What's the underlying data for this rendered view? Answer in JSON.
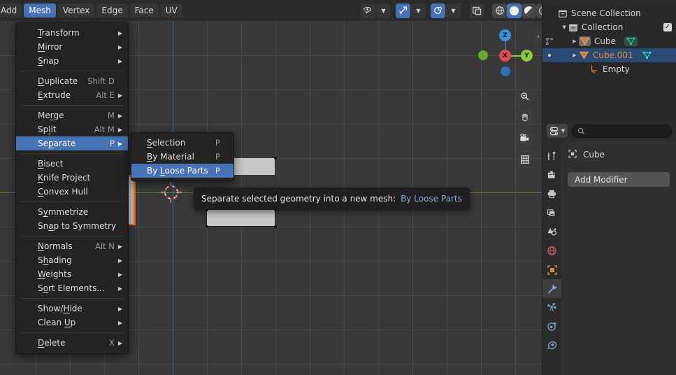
{
  "app": "Blender",
  "viewport": {
    "header": {
      "menus": [
        {
          "label": "Add",
          "active": false
        },
        {
          "label": "Mesh",
          "active": true
        },
        {
          "label": "Vertex",
          "active": false
        },
        {
          "label": "Edge",
          "active": false
        },
        {
          "label": "Face",
          "active": false
        },
        {
          "label": "UV",
          "active": false
        }
      ],
      "tools": [
        {
          "name": "visibility-selectability-icon",
          "label": "",
          "state": "off"
        },
        {
          "name": "snap-magnet-icon",
          "label": "",
          "state": "on"
        },
        {
          "name": "proportional-editing-icon",
          "label": "",
          "state": "on"
        },
        {
          "name": "toggle-xray-icon",
          "label": "",
          "state": "off"
        }
      ],
      "shading_modes": [
        {
          "name": "wireframe-shading",
          "selected": false
        },
        {
          "name": "solid-shading",
          "selected": true
        },
        {
          "name": "material-preview-shading",
          "selected": false
        },
        {
          "name": "rendered-shading",
          "selected": false
        }
      ]
    },
    "gizmo": {
      "axes": [
        {
          "label": "Z",
          "color": "#3d8fdd"
        },
        {
          "label": "X",
          "color": "#e04a5a"
        },
        {
          "label": "Y",
          "color": "#8dc63f"
        },
        {
          "label": "",
          "color": "#6aa82d"
        },
        {
          "label": "",
          "color": "#2f6fb5"
        }
      ]
    },
    "nav_buttons": [
      {
        "name": "zoom-view-icon"
      },
      {
        "name": "move-view-icon"
      },
      {
        "name": "camera-view-icon"
      },
      {
        "name": "toggle-orthographic-icon"
      }
    ],
    "sidebar_toggle": "‹",
    "cursor_3d": "3d-cursor"
  },
  "mesh_menu": {
    "title": "Mesh",
    "items": [
      {
        "label": "Transform",
        "under": "T",
        "shortcut": "",
        "arrow": true,
        "selected": false
      },
      {
        "label": "Mirror",
        "under": "M",
        "shortcut": "",
        "arrow": true,
        "selected": false
      },
      {
        "label": "Snap",
        "under": "S",
        "shortcut": "",
        "arrow": true,
        "selected": false
      },
      {
        "separator": true
      },
      {
        "label": "Duplicate",
        "under": "D",
        "shortcut": "Shift D",
        "arrow": false,
        "selected": false
      },
      {
        "label": "Extrude",
        "under": "E",
        "shortcut": "Alt E",
        "arrow": true,
        "selected": false
      },
      {
        "separator": true
      },
      {
        "label": "Merge",
        "under": "r",
        "shortcut": "M",
        "arrow": true,
        "selected": false
      },
      {
        "label": "Split",
        "under": "l",
        "shortcut": "Alt M",
        "arrow": true,
        "selected": false
      },
      {
        "label": "Separate",
        "under": "p",
        "shortcut": "P",
        "arrow": true,
        "selected": true
      },
      {
        "separator": true
      },
      {
        "label": "Bisect",
        "under": "B",
        "shortcut": "",
        "arrow": false,
        "selected": false
      },
      {
        "label": "Knife Project",
        "under": "K",
        "shortcut": "",
        "arrow": false,
        "selected": false
      },
      {
        "label": "Convex Hull",
        "under": "C",
        "shortcut": "",
        "arrow": false,
        "selected": false
      },
      {
        "separator": true
      },
      {
        "label": "Symmetrize",
        "under": "y",
        "shortcut": "",
        "arrow": false,
        "selected": false
      },
      {
        "label": "Snap to Symmetry",
        "under": "a",
        "shortcut": "",
        "arrow": false,
        "selected": false
      },
      {
        "separator": true
      },
      {
        "label": "Normals",
        "under": "N",
        "shortcut": "Alt N",
        "arrow": true,
        "selected": false
      },
      {
        "label": "Shading",
        "under": "h",
        "shortcut": "",
        "arrow": true,
        "selected": false
      },
      {
        "label": "Weights",
        "under": "W",
        "shortcut": "",
        "arrow": true,
        "selected": false
      },
      {
        "label": "Sort Elements...",
        "under": "o",
        "shortcut": "",
        "arrow": true,
        "selected": false
      },
      {
        "separator": true
      },
      {
        "label": "Show/Hide",
        "under": "H",
        "shortcut": "",
        "arrow": true,
        "selected": false
      },
      {
        "label": "Clean Up",
        "under": "U",
        "shortcut": "",
        "arrow": true,
        "selected": false
      },
      {
        "separator": true
      },
      {
        "label": "Delete",
        "under": "D",
        "shortcut": "X",
        "arrow": true,
        "selected": false
      }
    ]
  },
  "separate_submenu": {
    "items": [
      {
        "label": "Selection",
        "under": "S",
        "shortcut": "P",
        "selected": false
      },
      {
        "label": "By Material",
        "under": "B",
        "shortcut": "P",
        "selected": false
      },
      {
        "label": "By Loose Parts",
        "under": "L",
        "shortcut": "P",
        "selected": true
      }
    ]
  },
  "tooltip": {
    "text": "Separate selected geometry into a new mesh:",
    "value": "By Loose Parts"
  },
  "outliner": {
    "rows": [
      {
        "name": "Scene Collection",
        "indent": 0,
        "tri": "",
        "icon": "collection-icon",
        "selected": false,
        "checkbox": false,
        "orange": false
      },
      {
        "name": "Collection",
        "indent": 1,
        "tri": "▼",
        "icon": "collection-icon",
        "selected": false,
        "checkbox": true,
        "orange": false
      },
      {
        "name": "Cube",
        "indent": 2,
        "tri": "▶",
        "icon": "mesh-object-icon",
        "selected": false,
        "checkbox": false,
        "orange": false,
        "data_icon": "mesh-data-icon"
      },
      {
        "name": "Cube.001",
        "indent": 2,
        "tri": "▶",
        "icon": "mesh-object-icon",
        "selected": true,
        "checkbox": false,
        "orange": true,
        "data_icon": "mesh-data-icon"
      },
      {
        "name": "Empty",
        "indent": 3,
        "tri": "",
        "icon": "empty-plain-axes-icon",
        "selected": false,
        "checkbox": false,
        "orange": false
      }
    ]
  },
  "properties": {
    "editor_type": "properties-editor-icon",
    "search_placeholder": "",
    "breadcrumb": "Cube",
    "add_modifier_label": "Add Modifier",
    "tabs": [
      {
        "name": "tool-tab",
        "selected": false
      },
      {
        "name": "render-tab",
        "selected": false
      },
      {
        "name": "output-tab",
        "selected": false
      },
      {
        "name": "view-layer-tab",
        "selected": false
      },
      {
        "name": "scene-tab",
        "selected": false
      },
      {
        "name": "world-tab",
        "selected": false
      },
      {
        "name": "object-tab",
        "selected": false
      },
      {
        "name": "modifier-tab",
        "selected": true
      },
      {
        "name": "particles-tab",
        "selected": false
      },
      {
        "name": "physics-tab",
        "selected": false
      },
      {
        "name": "object-constraints-tab",
        "selected": false
      }
    ]
  },
  "colors": {
    "accent_blue": "#4772b3",
    "selected_row": "#2a4a73",
    "orange_text": "#e88b3a",
    "axis_x_blue": "#3b6ec0",
    "axis_y_green": "#5d7e33",
    "edge_select": "#ec6b20",
    "viewport_bg": "#393939",
    "panel_bg": "#303030",
    "header_bg": "#2b2b2b"
  }
}
